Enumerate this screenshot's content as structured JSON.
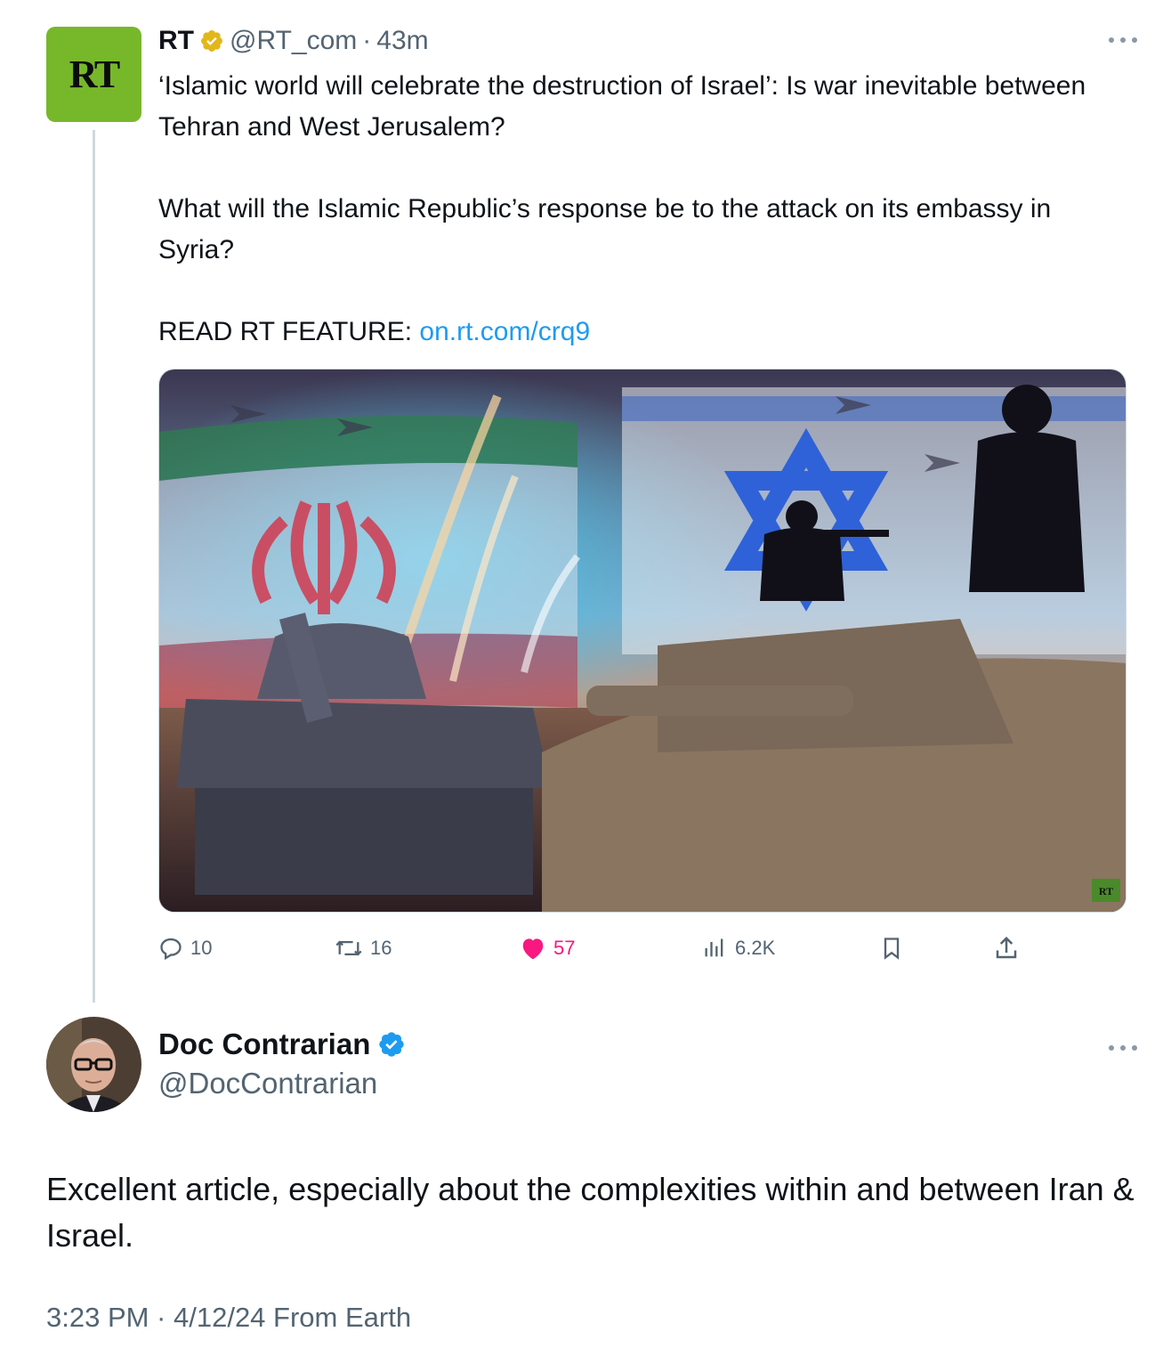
{
  "original_tweet": {
    "author_name": "RT",
    "avatar_label": "RT",
    "handle": "@RT_com",
    "separator": "·",
    "time_ago": "43m",
    "text_lines": [
      "‘Islamic world will celebrate the destruction of Israel’: Is war inevitable between Tehran and West Jerusalem?",
      "What will the Islamic Republic’s response be to the attack on its embassy in Syria?"
    ],
    "read_label": "READ RT FEATURE: ",
    "link_text": "on.rt.com/crq9",
    "media_watermark": "RT",
    "actions": {
      "replies": "10",
      "reposts": "16",
      "likes": "57",
      "views": "6.2K"
    },
    "badge_color": "#e2b719",
    "avatar_color": "#77b82a"
  },
  "reply_tweet": {
    "author_name": "Doc Contrarian",
    "handle": "@DocContrarian",
    "text": "Excellent article, especially about the complexities within and between Iran & Israel.",
    "timestamp": "3:23 PM · 4/12/24 From Earth",
    "badge_color": "#1d9bf0"
  },
  "colors": {
    "link": "#1d9bf0",
    "like": "#f91880",
    "secondary_text": "#536471",
    "thread_line": "#cfd9de"
  }
}
